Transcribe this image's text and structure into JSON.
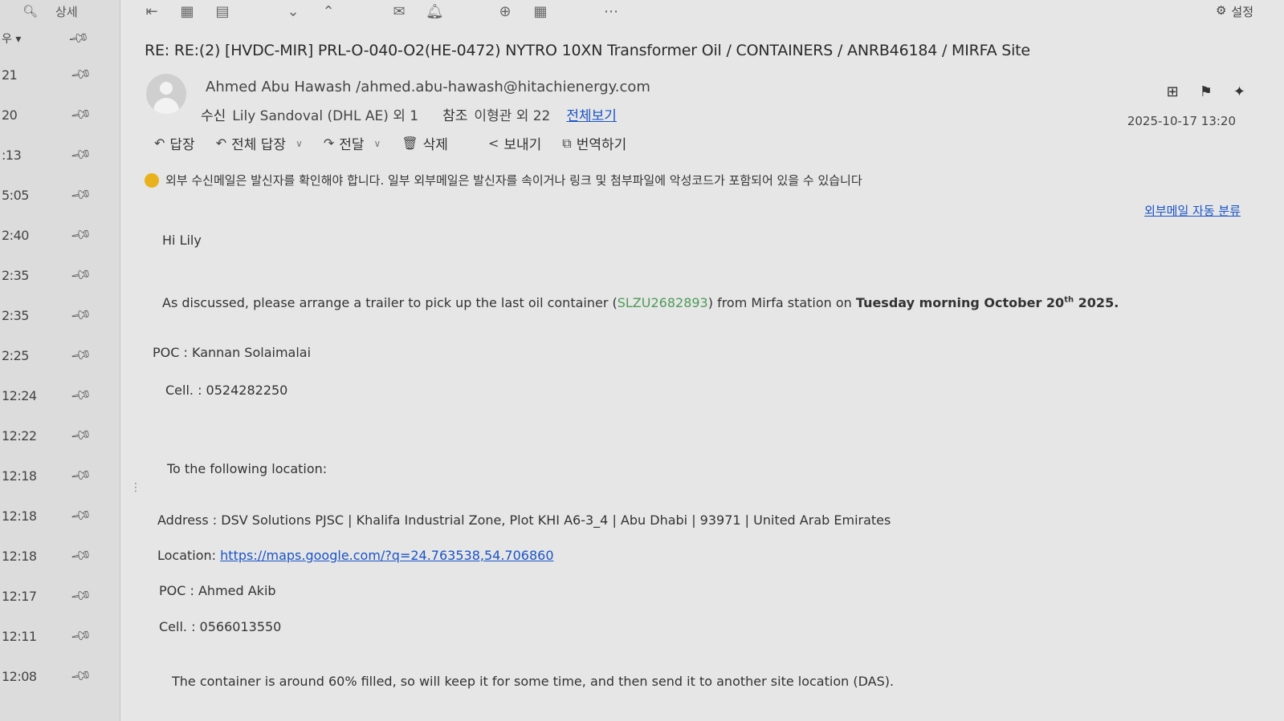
{
  "left_panel": {
    "search_icon": "search-icon",
    "detail_label": "상세",
    "sort_label": "우 ▾",
    "items": [
      {
        "time": "21"
      },
      {
        "time": "20"
      },
      {
        "time": ":13"
      },
      {
        "time": "5:05"
      },
      {
        "time": "2:40"
      },
      {
        "time": "2:35"
      },
      {
        "time": "2:35"
      },
      {
        "time": "2:25"
      },
      {
        "time": "12:24"
      },
      {
        "time": "12:22"
      },
      {
        "time": "12:18"
      },
      {
        "time": "12:18"
      },
      {
        "time": "12:18"
      },
      {
        "time": "12:17"
      },
      {
        "time": "12:11"
      },
      {
        "time": "12:08"
      }
    ]
  },
  "toolbar": {
    "settings_label": "설정"
  },
  "email": {
    "subject": "RE: RE:(2) [HVDC-MIR] PRL-O-040-O2(HE-0472) NYTRO 10XN Transformer Oil / CONTAINERS / ANRB46184 / MIRFA Site",
    "sender": "Ahmed Abu Hawash  /ahmed.abu-hawash@hitachienergy.com",
    "to_label": "수신",
    "to_value": "Lily Sandoval (DHL AE) 외 1",
    "cc_label": "참조",
    "cc_value": "이형관 외 22",
    "view_all": "전체보기",
    "date": "2025-10-17 13:20"
  },
  "actions": {
    "reply": "답장",
    "reply_all": "전체 답장",
    "forward": "전달",
    "delete": "삭제",
    "send": "보내기",
    "translate": "번역하기"
  },
  "warning": {
    "text": "외부 수신메일은 발신자를 확인해야 합니다. 일부 외부메일은 발신자를 속이거나 링크 및 첨부파일에 악성코드가 포함되어 있을 수 있습니다",
    "auto_classify": "외부메일 자동 분류"
  },
  "body": {
    "greeting": "Hi Lily",
    "para1_a": "As discussed, please arrange a trailer to pick up the last oil container (",
    "container_id": "SLZU2682893",
    "para1_b": ") from Mirfa station on ",
    "para1_bold": "Tuesday morning October 20",
    "para1_sup": "th",
    "para1_end": " 2025.",
    "poc1": "POC : Kannan Solaimalai",
    "cell1": "Cell.  : 0524282250",
    "to_location": "To the following location:",
    "address": "Address : DSV Solutions PJSC | Khalifa Industrial Zone, Plot KHI A6-3_4 | Abu Dhabi | 93971 | United Arab Emirates",
    "location_label": "Location: ",
    "location_link": "https://maps.google.com/?q=24.763538,54.706860",
    "poc2": "POC : Ahmed Akib",
    "cell2": "Cell.  : 0566013550",
    "closing": "The container is around 60% filled, so will keep it for some time, and then send it to another site location (DAS)."
  }
}
